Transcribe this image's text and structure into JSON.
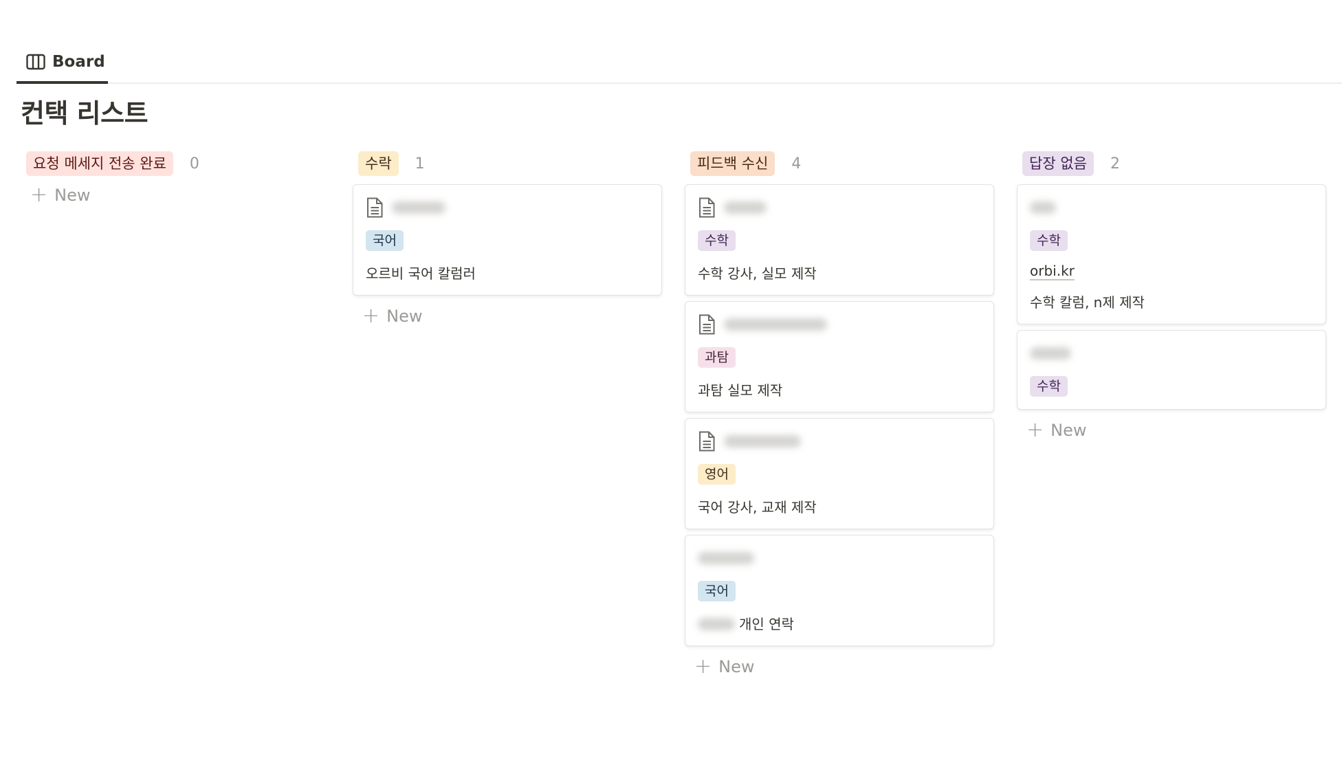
{
  "view_tab": {
    "label": "Board",
    "icon": "board-view-icon"
  },
  "page": {
    "title": "컨택 리스트"
  },
  "colors": {
    "tag_korean_bg": "#d3e5ef",
    "tag_korean_fg": "#183347",
    "tag_math_bg": "#e8deee",
    "tag_math_fg": "#412454",
    "tag_science_bg": "#f5e0e9",
    "tag_science_fg": "#4c2337",
    "tag_english_bg": "#fdecc8",
    "tag_english_fg": "#402c1b"
  },
  "columns": [
    {
      "label": "요청 메세지 전송 완료",
      "count": "0",
      "new_label": "New",
      "pill_bg": "#ffe2dd",
      "pill_fg": "#5d1715"
    },
    {
      "label": "수락",
      "count": "1",
      "new_label": "New",
      "pill_bg": "#fdecc8",
      "pill_fg": "#402c1b",
      "cards": [
        {
          "tag": "국어",
          "text": "오르비 국어 칼럼러"
        }
      ]
    },
    {
      "label": "피드백 수신",
      "count": "4",
      "new_label": "New",
      "pill_bg": "#fadec9",
      "pill_fg": "#49290e",
      "cards": [
        {
          "tag": "수학",
          "text": "수학 강사, 실모 제작"
        },
        {
          "tag": "과탐",
          "text": "과탐 실모 제작"
        },
        {
          "tag": "영어",
          "text": "국어 강사, 교재 제작"
        },
        {
          "tag": "국어",
          "text": "개인 연락"
        }
      ]
    },
    {
      "label": "답장 없음",
      "count": "2",
      "new_label": "New",
      "pill_bg": "#e8deee",
      "pill_fg": "#412454",
      "cards": [
        {
          "tag": "수학",
          "link": "orbi.kr",
          "text": "수학 칼럼, n제 제작"
        },
        {
          "tag": "수학"
        }
      ]
    }
  ]
}
